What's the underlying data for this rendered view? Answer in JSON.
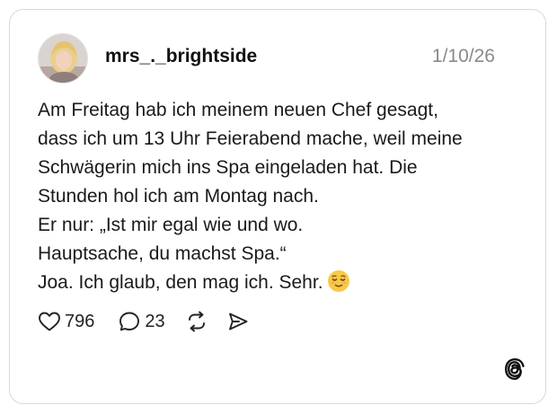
{
  "post": {
    "username": "mrs_._brightside",
    "date": "1/10/26",
    "lines": [
      "Am Freitag hab ich meinem neuen Chef gesagt,",
      "dass ich um 13 Uhr Feierabend mache, weil meine",
      "Schwägerin mich ins Spa eingeladen hat. Die",
      "Stunden hol ich am Montag nach.",
      "Er nur: „Ist mir egal wie und wo.",
      "Hauptsache, du machst Spa.“",
      "Joa. Ich glaub, den mag ich. Sehr."
    ],
    "emoji": "relieved-face-emoji"
  },
  "actions": {
    "likes": "796",
    "replies": "23",
    "like_icon": "heart-icon",
    "reply_icon": "speech-bubble-icon",
    "repost_icon": "repost-icon",
    "share_icon": "send-icon"
  },
  "branding": {
    "logo": "threads-logo-icon"
  },
  "colors": {
    "text": "#111111",
    "muted": "#8a8a8a",
    "border": "#d8d8d8",
    "emoji": "#f7c948"
  }
}
